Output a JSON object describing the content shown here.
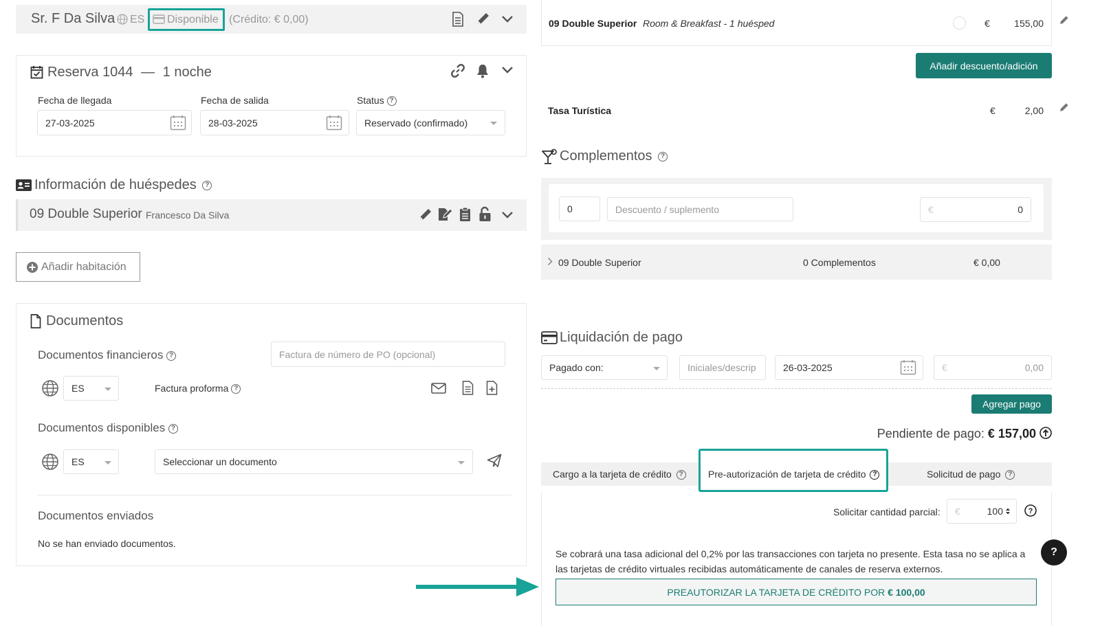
{
  "guest_header": {
    "name": "Sr. F Da Silva",
    "lang": "ES",
    "status": "Disponible",
    "credit": "(Crédito: € 0,00)"
  },
  "reservation": {
    "title": "Reserva 1044",
    "separator": "—",
    "nights": "1 noche",
    "arrival_label": "Fecha de llegada",
    "arrival_value": "27-03-2025",
    "departure_label": "Fecha de salida",
    "departure_value": "28-03-2025",
    "status_label": "Status",
    "status_value": "Reservado (confirmado)"
  },
  "guests": {
    "title": "Información de huéspedes",
    "room": "09 Double Superior",
    "guest_name": "Francesco Da Silva",
    "add_room": "Añadir habitación"
  },
  "documents": {
    "title": "Documentos",
    "financial_label": "Documentos financieros",
    "po_placeholder": "Factura de número de PO (opcional)",
    "lang1": "ES",
    "proforma": "Factura proforma",
    "available_label": "Documentos disponibles",
    "lang2": "ES",
    "select_doc": "Seleccionar un documento",
    "sent_label": "Documentos enviados",
    "no_sent": "No se han enviado documentos."
  },
  "rate": {
    "room": "09 Double Superior",
    "plan": "Room & Breakfast - 1 huésped",
    "currency": "€",
    "amount": "155,00",
    "add_discount": "Añadir descuento/adición",
    "tax_label": "Tasa Turística",
    "tax_currency": "€",
    "tax_amount": "2,00"
  },
  "addons": {
    "title": "Complementos",
    "qty": "0",
    "desc_placeholder": "Descuento / suplemento",
    "euro": "€",
    "amount": "0",
    "row_room": "09 Double Superior",
    "row_count": "0 Complementos",
    "row_total": "€ 0,00"
  },
  "payment": {
    "title": "Liquidación de pago",
    "paid_with": "Pagado con:",
    "initials_placeholder": "Iniciales/descrip",
    "date": "26-03-2025",
    "euro": "€",
    "amount": "0,00",
    "add_payment": "Agregar pago",
    "pending_label": "Pendiente de pago:",
    "pending_value": "€ 157,00",
    "tab_charge": "Cargo a la tarjeta de crédito",
    "tab_preauth": "Pre-autorización de tarjeta de crédito",
    "tab_request": "Solicitud de pago",
    "partial_label": "Solicitar cantidad parcial:",
    "partial_euro": "€",
    "partial_value": "100",
    "fee_note": "Se cobrará una tasa adicional del 0,2% por las transacciones con tarjeta no presente. Esta tasa no se aplica a las tarjetas de crédito virtuales recibidas automáticamente de canales de reserva externos.",
    "preauth_button": "PREAUTORIZAR LA TARJETA DE CRÉDITO POR",
    "preauth_amount": "€ 100,00"
  },
  "help_bubble": "?",
  "colors": {
    "accent": "#1b7c74",
    "highlight": "#17a398",
    "panel_gray": "#f2f2f2"
  }
}
